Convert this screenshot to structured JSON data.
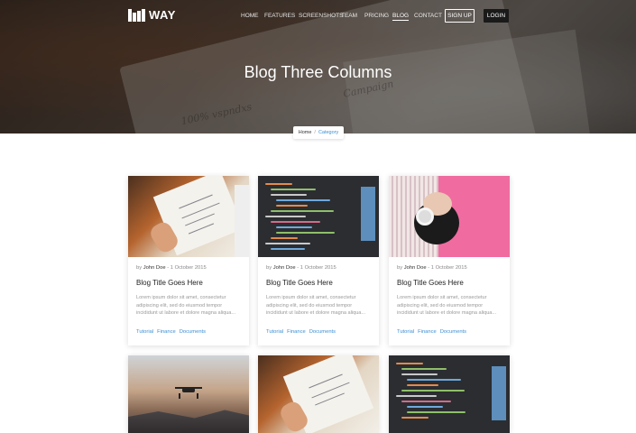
{
  "app": {
    "logo_text": "WAY"
  },
  "nav": {
    "items": [
      {
        "label": "HOME"
      },
      {
        "label": "FEATURES"
      },
      {
        "label": "SCREENSHOTS"
      },
      {
        "label": "TEAM"
      },
      {
        "label": "PRICING"
      },
      {
        "label": "BLOG"
      },
      {
        "label": "CONTACT"
      }
    ],
    "signup_label": "SIGN UP",
    "login_label": "LOGIN"
  },
  "hero": {
    "title": "Blog Three Columns"
  },
  "breadcrumb": {
    "home": "Home",
    "separator": "/",
    "current": "Category"
  },
  "posts": [
    {
      "by": "by",
      "author": "John Doe",
      "dash": "-",
      "date": "1 October 2015",
      "title": "Blog Title Goes Here",
      "excerpt": "Lorem ipsum dolor sit amet, consectetur adipiscing elit, sed do eiusmod tempor incididunt ut labore et dolore magna aliqua...",
      "tags": [
        "Tutorial",
        "Finance",
        "Documents"
      ]
    },
    {
      "by": "by",
      "author": "John Doe",
      "dash": "-",
      "date": "1 October 2015",
      "title": "Blog Title Goes Here",
      "excerpt": "Lorem ipsum dolor sit amet, consectetur adipiscing elit, sed do eiusmod tempor incididunt ut labore et dolore magna aliqua...",
      "tags": [
        "Tutorial",
        "Finance",
        "Documents"
      ]
    },
    {
      "by": "by",
      "author": "John Doe",
      "dash": "-",
      "date": "1 October 2015",
      "title": "Blog Title Goes Here",
      "excerpt": "Lorem ipsum dolor sit amet, consectetur adipiscing elit, sed do eiusmod tempor incididunt ut labore et dolore magna aliqua...",
      "tags": [
        "Tutorial",
        "Finance",
        "Documents"
      ]
    }
  ],
  "colors": {
    "accent": "#3b8fd4",
    "login_bg": "#1a1a1a"
  }
}
